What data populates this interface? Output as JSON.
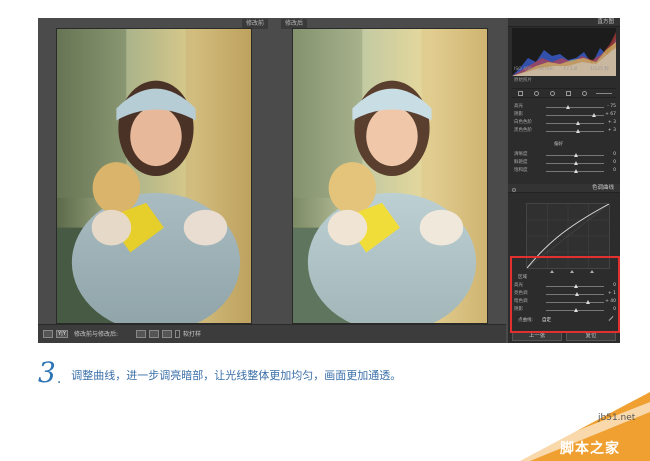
{
  "compare": {
    "before_label": "修改前",
    "after_label": "修改后"
  },
  "toolbar": {
    "mode_badge": "Y|Y",
    "mode_label": "修改前与修改后:",
    "softproof_label": "软打样"
  },
  "panel": {
    "histogram_title": "直方图",
    "histogram_info": [
      "ISO 400",
      "50 mm",
      "f / 1.8",
      "1/125 秒"
    ],
    "original_photo_label": "原始照片",
    "basic_rows": [
      {
        "label": "高光",
        "value": "- 75"
      },
      {
        "label": "阴影",
        "value": "+ 67"
      },
      {
        "label": "白色色阶",
        "value": "+ 3"
      },
      {
        "label": "黑色色阶",
        "value": "+ 3"
      }
    ],
    "presence_title": "偏好",
    "presence_rows": [
      {
        "label": "清晰度",
        "value": "0"
      },
      {
        "label": "鲜艳度",
        "value": "0"
      },
      {
        "label": "饱和度",
        "value": "0"
      }
    ],
    "tone_curve_title": "色调曲线",
    "region_title": "区域",
    "region_rows": [
      {
        "label": "高光",
        "value": "0"
      },
      {
        "label": "亮色调",
        "value": "+ 1"
      },
      {
        "label": "暗色调",
        "value": "+ 40"
      },
      {
        "label": "阴影",
        "value": "0"
      }
    ],
    "point_curve_label": "点曲线:",
    "point_curve_value": "自定",
    "prev_button": "上一张",
    "reset_button": "复位"
  },
  "caption": {
    "step_number": "3",
    "step_dot": ".",
    "text": "调整曲线，进一步调亮暗部，让光线整体更加均匀，画面更加通透。"
  },
  "watermark": {
    "site": "jb51.net",
    "name": "脚本之家"
  },
  "colors": {
    "accent_blue": "#2c74b3",
    "highlight_red": "#e03030",
    "watermark_orange": "#f0a030"
  }
}
